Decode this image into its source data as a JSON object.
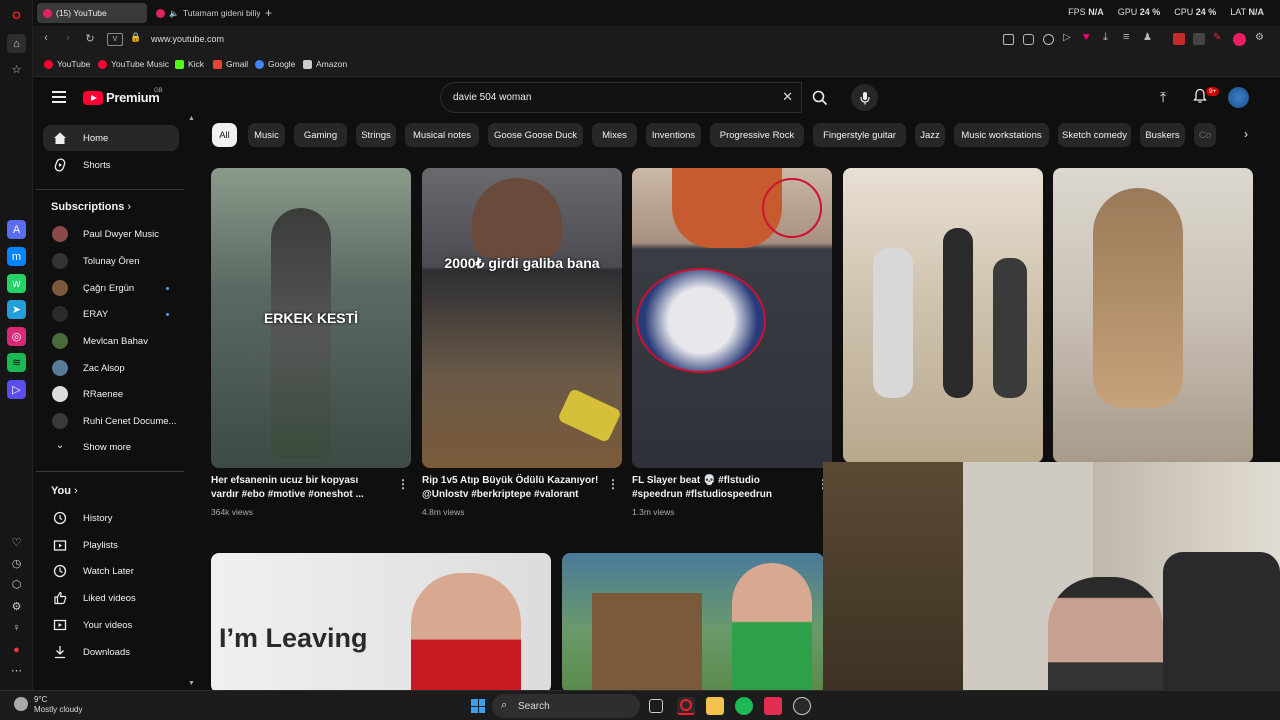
{
  "browser": {
    "tabs": [
      {
        "label": "(15) YouTube"
      },
      {
        "label": "Tutamam gideni biliyo"
      }
    ],
    "new_tab": "+",
    "perf": {
      "fps_label": "FPS",
      "fps_value": "N/A",
      "gpu_label": "GPU",
      "gpu_value": "24 %",
      "cpu_label": "CPU",
      "cpu_value": "24 %",
      "lat_label": "LAT",
      "lat_value": "N/A"
    },
    "url": "www.youtube.com",
    "bookmarks": [
      {
        "label": "YouTube",
        "color": "#ff0033"
      },
      {
        "label": "YouTube Music",
        "color": "#ff0033"
      },
      {
        "label": "Kick",
        "color": "#53fc18"
      },
      {
        "label": "Gmail",
        "color": "#ea4335"
      },
      {
        "label": "Google",
        "color": "#4285f4"
      },
      {
        "label": "Amazon",
        "color": "#cccccc"
      }
    ]
  },
  "youtube": {
    "logo_text": "Premium",
    "country_code": "GB",
    "search_value": "davie 504 woman",
    "notification_count": "9+",
    "sidebar": {
      "main": [
        {
          "label": "Home"
        },
        {
          "label": "Shorts"
        }
      ],
      "subscriptions_heading": "Subscriptions",
      "subscriptions": [
        {
          "label": "Paul Dwyer Music",
          "color": "#8a4a4a"
        },
        {
          "label": "Tolunay Ören",
          "color": "#333333"
        },
        {
          "label": "Çağrı Ergün",
          "color": "#7a5a3a"
        },
        {
          "label": "ERAY",
          "color": "#2a2a2a"
        },
        {
          "label": "Mevlcan Bahav",
          "color": "#4a6a3a"
        },
        {
          "label": "Zac Alsop",
          "color": "#5a7a9a"
        },
        {
          "label": "RRaenee",
          "color": "#dddddd"
        },
        {
          "label": "Ruhi Cenet Docume...",
          "color": "#3a3a3a"
        }
      ],
      "show_more": "Show more",
      "you_heading": "You",
      "you_items": [
        {
          "label": "History"
        },
        {
          "label": "Playlists"
        },
        {
          "label": "Watch Later"
        },
        {
          "label": "Liked videos"
        },
        {
          "label": "Your videos"
        },
        {
          "label": "Downloads"
        }
      ]
    },
    "chips": [
      "All",
      "Music",
      "Gaming",
      "Strings",
      "Musical notes",
      "Goose Goose Duck",
      "Mixes",
      "Inventions",
      "Progressive Rock",
      "Fingerstyle guitar",
      "Jazz",
      "Music workstations",
      "Sketch comedy",
      "Buskers",
      "Co"
    ],
    "shorts": [
      {
        "title": "Her efsanenin ucuz bir kopyası vardır #ebo #motive #oneshot ...",
        "views": "364k views",
        "overlay": "ERKEK KESTİ"
      },
      {
        "title": "Rip 1v5 Atıp Büyük Ödülü Kazanıyor! @Unlostv #berkriptepe #valorant",
        "views": "4.8m views",
        "overlay": "2000₺ girdi galiba bana"
      },
      {
        "title": "FL Slayer beat 💀 #flstudio #speedrun #flstudiospeedrun",
        "views": "1.3m views",
        "overlay": ""
      },
      {
        "title": "",
        "views": "",
        "overlay": ""
      },
      {
        "title": "",
        "views": "",
        "overlay": ""
      }
    ],
    "videos": [
      {
        "overlay": "I’m Leaving"
      },
      {
        "overlay": ""
      }
    ]
  },
  "taskbar": {
    "temperature": "9°C",
    "weather": "Mostly cloudy",
    "search_label": "Search"
  }
}
